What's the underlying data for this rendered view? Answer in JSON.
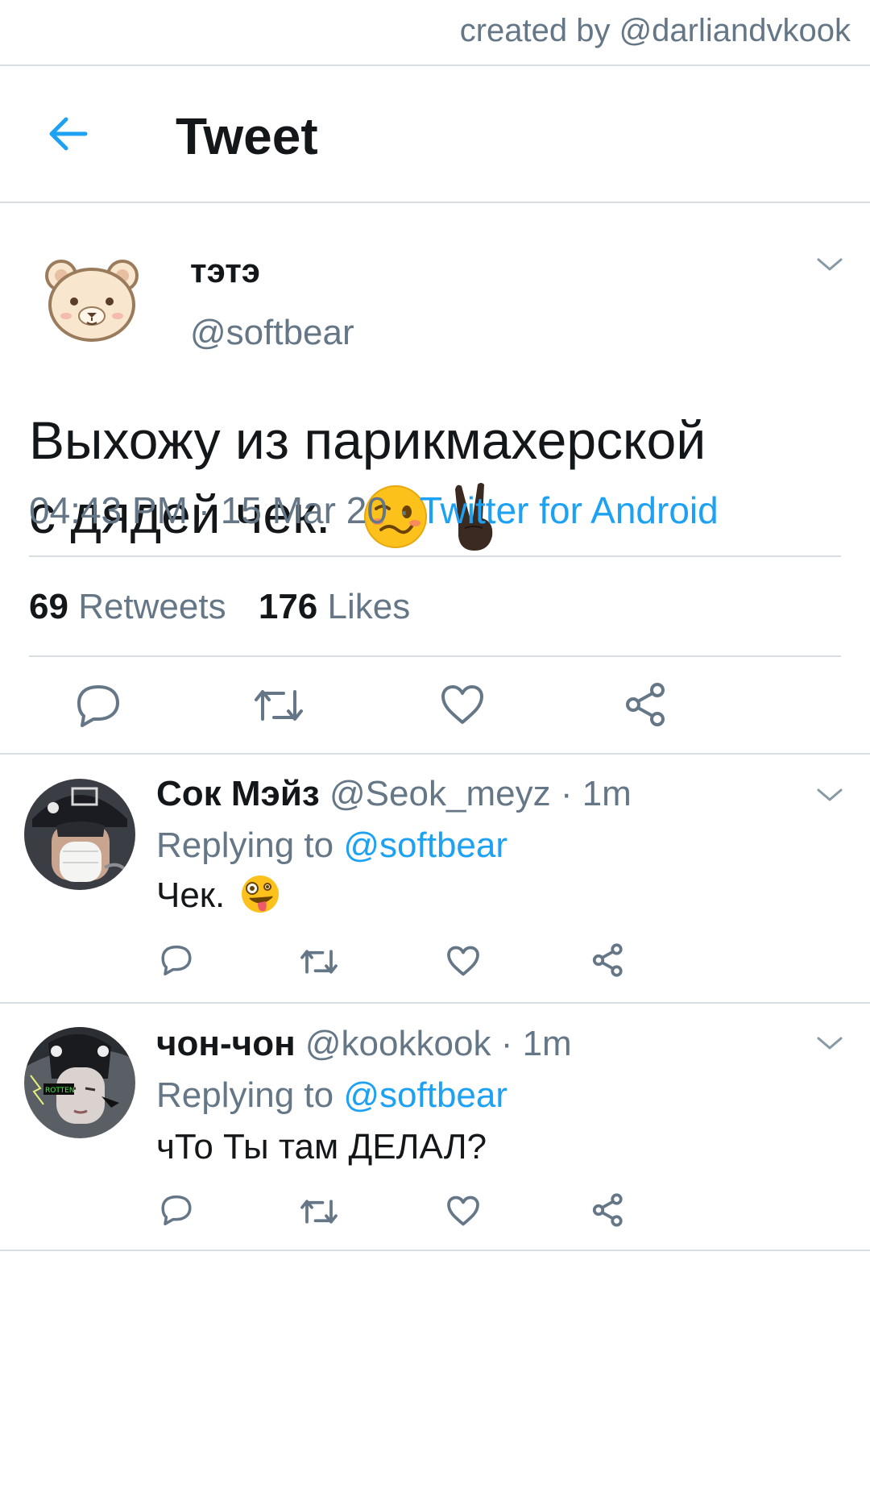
{
  "credit": "created by @darliandvkook",
  "header": {
    "title": "Tweet"
  },
  "tweet": {
    "display_name": "тэтэ",
    "handle": "@softbear",
    "text_line1": "Выхожу из парикмахерской",
    "text_line2": "с дядей чек.",
    "time": "04:43 PM",
    "date": "15 Mar 20",
    "separator": "·",
    "source": "Twitter for Android",
    "retweets_count": "69",
    "retweets_label": "Retweets",
    "likes_count": "176",
    "likes_label": "Likes"
  },
  "replies": [
    {
      "display_name": "Сок Мэйз",
      "handle": "@Seok_meyz",
      "time": "1m",
      "replying_prefix": "Replying to",
      "replying_handle": "@softbear",
      "text": "Чек."
    },
    {
      "display_name": "чон-чон",
      "handle": "@kookkook",
      "time": "1m",
      "replying_prefix": "Replying to",
      "replying_handle": "@softbear",
      "text": "чТо Ты там ДЕЛАЛ?",
      "avatar_sticker": "ROTTEN"
    }
  ],
  "icons": [
    "arrow-left",
    "chevron-down",
    "reply",
    "retweet",
    "heart",
    "share",
    "woozy-face",
    "victory-hand",
    "zany-face"
  ],
  "colors": {
    "accent": "#1da1f2",
    "secondary_text": "#657786",
    "divider": "#d9dee2"
  }
}
